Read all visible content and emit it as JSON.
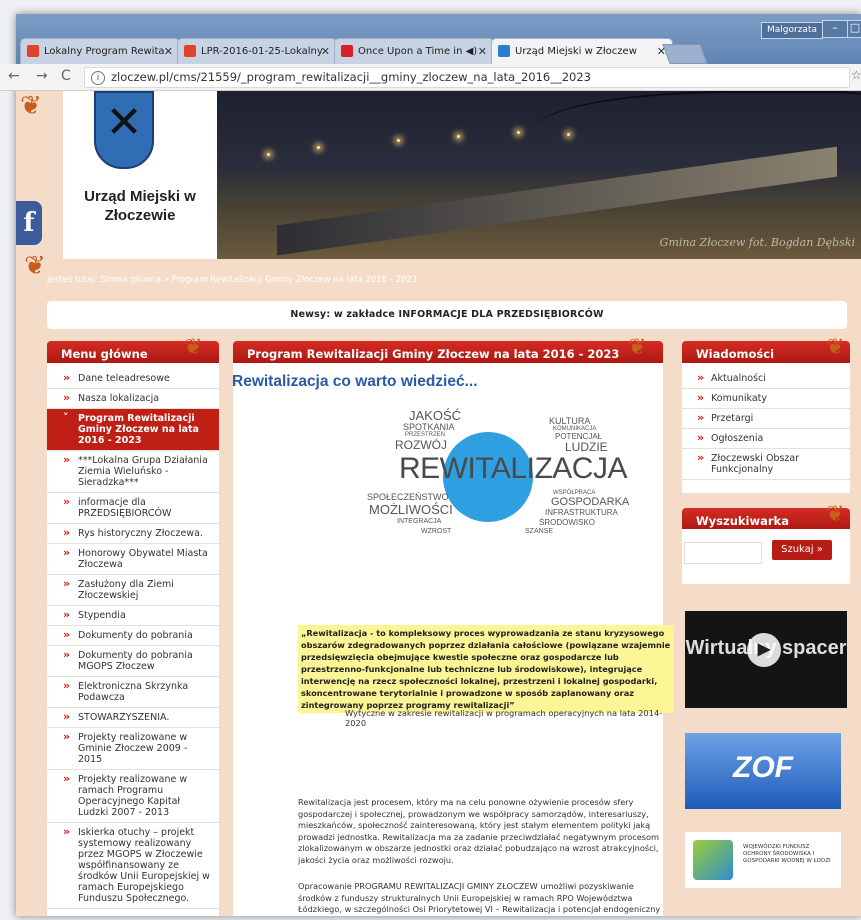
{
  "browser": {
    "user": "Malgorzata",
    "tabs": [
      {
        "label": "Lokalny Program Rewita",
        "favicon_color": "#e2412a"
      },
      {
        "label": "LPR-2016-01-25-Lokalny",
        "favicon_color": "#e2412a"
      },
      {
        "label": "Once Upon a Time in",
        "favicon_color": "#d81f26"
      },
      {
        "label": "Urząd Miejski w Złoczew",
        "favicon_color": "#2b7bd2"
      }
    ],
    "url": "zloczew.pl/cms/21559/_program_rewitalizacji__gminy_zloczew_na_lata_2016__2023"
  },
  "site": {
    "name": "Urząd Miejski w Złoczewie",
    "banner_credit": "Gmina Złoczew fot. Bogdan Dębski",
    "breadcrumb_label": "Jesteś tutaj:",
    "breadcrumb_home": "Strona główna",
    "breadcrumb_sep": "»",
    "breadcrumb_current": "Program Rewitalizacji Gminy Złoczew na lata 2016 - 2023",
    "news": "Newsy: w zakładce INFORMACJE DLA PRZEDSIĘBIORCÓW"
  },
  "left_menu": {
    "title": "Menu główne",
    "items": [
      "Dane teleadresowe",
      "Nasza lokalizacja",
      "Program Rewitalizacji Gminy Złoczew na lata 2016 - 2023",
      "***Lokalna Grupa Działania Ziemia Wieluńsko - Sieradzka***",
      "informacje dla PRZEDSIĘBIORCÓW",
      "Rys historyczny Złoczewa.",
      "Honorowy Obywatel Miasta Złoczewa",
      "Zasłużony dla Ziemi Złoczewskiej",
      "Stypendia",
      "Dokumenty do pobrania",
      "Dokumenty do pobrania MGOPS Złoczew",
      "Elektroniczna Skrzynka Podawcza",
      "STOWARZYSZENIA.",
      "Projekty realizowane w Gminie Złoczew 2009 - 2015",
      "Projekty realizowane w ramach Programu Operacyjnego Kapitał Ludzki 2007 - 2013",
      "Iskierka otuchy – projekt systemowy realizowany przez MGOPS w Złoczewie współfinansowany ze środków Unii Europejskiej w ramach Europejskiego Funduszu Społecznego."
    ]
  },
  "content": {
    "header": "Program Rewitalizacji Gminy Złoczew na lata 2016 - 2023",
    "title": "Rewitalizacja co warto wiedzieć...",
    "graphic": {
      "main_word": "REWITALIZACJA",
      "words": [
        "JAKOŚĆ",
        "SPOTKANIA",
        "PRZESTRZEŃ",
        "ROZWÓJ",
        "KULTURA",
        "KOMUNIKACJA",
        "POTENCJAŁ",
        "LUDZIE",
        "SPOŁECZEŃSTWO",
        "MOŻLIWOŚCI",
        "INTEGRACJA",
        "WZROST",
        "WSPÓŁPRACA",
        "GOSPODARKA",
        "INFRASTRUKTURA",
        "ŚRODOWISKO",
        "SZANSE"
      ]
    },
    "quote": "„Rewitalizacja - to kompleksowy proces wyprowadzania ze stanu kryzysowego obszarów zdegradowanych poprzez działania całościowe (powiązane wzajemnie przedsięwzięcia obejmujące kwestie społeczne oraz gospodarcze lub przestrzenno-funkcjonalne lub techniczne lub środowiskowe), integrujące interwencję na rzecz społeczności lokalnej, przestrzeni i lokalnej gospodarki, skoncentrowane terytorialnie i prowadzone w sposób zaplanowany oraz zintegrowany poprzez programy rewitalizacji”",
    "quote_source": "Wytyczne w zakresie rewitalizacji w programach operacyjnych na lata 2014-2020",
    "paragraph1": "Rewitalizacja jest procesem, który ma na celu ponowne ożywienie procesów sfery gospodarczej i społecznej, prowadzonym we współpracy samorządów, interesariuszy, mieszkańców, społeczność zainteresowaną, który jest stałym elementem polityki jaką prowadzi jednostka. Rewitalizacja ma za zadanie przeciwdziałać negatywnym procesom zlokalizowanym w obszarze jednostki oraz działać pobudzająco na wzrost atrakcyjności, jakości życia oraz możliwości rozwoju.",
    "paragraph2": "Opracowanie PROGRAMU REWITALIZACJI GMINY ZŁOCZEW umożliwi pozyskiwanie środków z funduszy strukturalnych Unii Europejskiej w ramach RPO Województwa Łódzkiego, w szczególności Osi Priorytetowej VI – Rewitalizacja i potencjał endogeniczny regionu."
  },
  "right": {
    "news_title": "Wiadomości",
    "news_items": [
      "Aktualności",
      "Komunikaty",
      "Przetargi",
      "Ogłoszenia",
      "Złoczewski Obszar Funkcjonalny"
    ],
    "search_title": "Wyszukiwarka",
    "search_button": "Szukaj »",
    "search_placeholder": "",
    "video_label": "Wirtualny spacer",
    "zof_label": "ZOF",
    "wfos_label": "WOJEWÓDZKI FUNDUSZ OCHRONY ŚRODOWISKA I GOSPODARKI WODNEJ W ŁODZI"
  }
}
